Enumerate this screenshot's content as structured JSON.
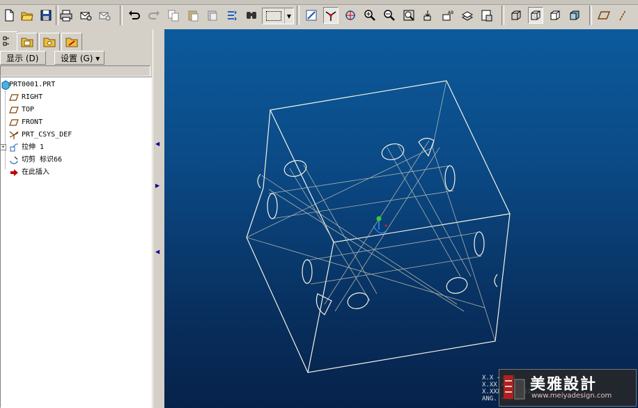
{
  "toolbar": {
    "icons": [
      "new-file-icon",
      "open-folder-icon",
      "save-icon",
      "print-icon",
      "email-icon",
      "email-alt-icon",
      "undo-icon",
      "redo-icon",
      "copy-icon",
      "paste-icon",
      "paste-special-icon",
      "regenerate-icon",
      "find-icon",
      "select-box-combo",
      "repaint-icon",
      "spin-center-icon",
      "orient-icon",
      "zoom-in-icon",
      "zoom-out-icon",
      "refit-icon",
      "named-view-icon",
      "layer-icon",
      "view-manager-icon",
      "wireframe-icon",
      "hidden-line-icon",
      "no-hidden-icon",
      "shaded-icon",
      "datum-plane-icon",
      "datum-axis-icon"
    ]
  },
  "left_pane": {
    "tabs": [
      "model-tree-tab",
      "folder-browser-tab",
      "favorites-tab",
      "connections-tab"
    ],
    "show_menu": "显示 (D) ▾",
    "settings_menu": "设置 (G) ▾"
  },
  "model_tree": {
    "root": "PRT0001.PRT",
    "items": [
      {
        "label": "RIGHT",
        "icon": "datum-plane-icon"
      },
      {
        "label": "TOP",
        "icon": "datum-plane-icon"
      },
      {
        "label": "FRONT",
        "icon": "datum-plane-icon"
      },
      {
        "label": "PRT_CSYS_DEF",
        "icon": "csys-icon"
      },
      {
        "label": "拉伸 1",
        "icon": "extrude-icon"
      },
      {
        "label": "切剪 标识66",
        "icon": "cut-icon"
      },
      {
        "label": "在此插入",
        "icon": "insert-here-icon"
      }
    ]
  },
  "viewport": {
    "readout": [
      "X.X   +-0.1",
      "X.XX  +-0.01",
      "X.XXX +-0.001",
      "ANG.  +-0.5"
    ],
    "background_top": "#0c5a9c",
    "background_bottom": "#06224a"
  },
  "watermark": {
    "title": "美雅設計",
    "url": "www.meiyadesign.com"
  }
}
